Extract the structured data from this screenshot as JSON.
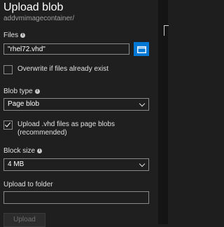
{
  "header": {
    "title": "Upload blob",
    "subtitle": "addvmimagecontainer/"
  },
  "files": {
    "label": "Files",
    "value": "\"rhel72.vhd\""
  },
  "overwrite": {
    "label": "Overwrite if files already exist",
    "checked": false
  },
  "blob_type": {
    "label": "Blob type",
    "selected": "Page blob"
  },
  "upload_vhd": {
    "line1": "Upload .vhd files as page blobs",
    "line2": "(recommended)",
    "checked": true
  },
  "block_size": {
    "label": "Block size",
    "selected": "4 MB"
  },
  "upload_folder": {
    "label": "Upload to folder",
    "value": ""
  },
  "actions": {
    "upload_label": "Upload"
  },
  "colors": {
    "accent": "#0078d4",
    "background": "#1f1f1f"
  }
}
